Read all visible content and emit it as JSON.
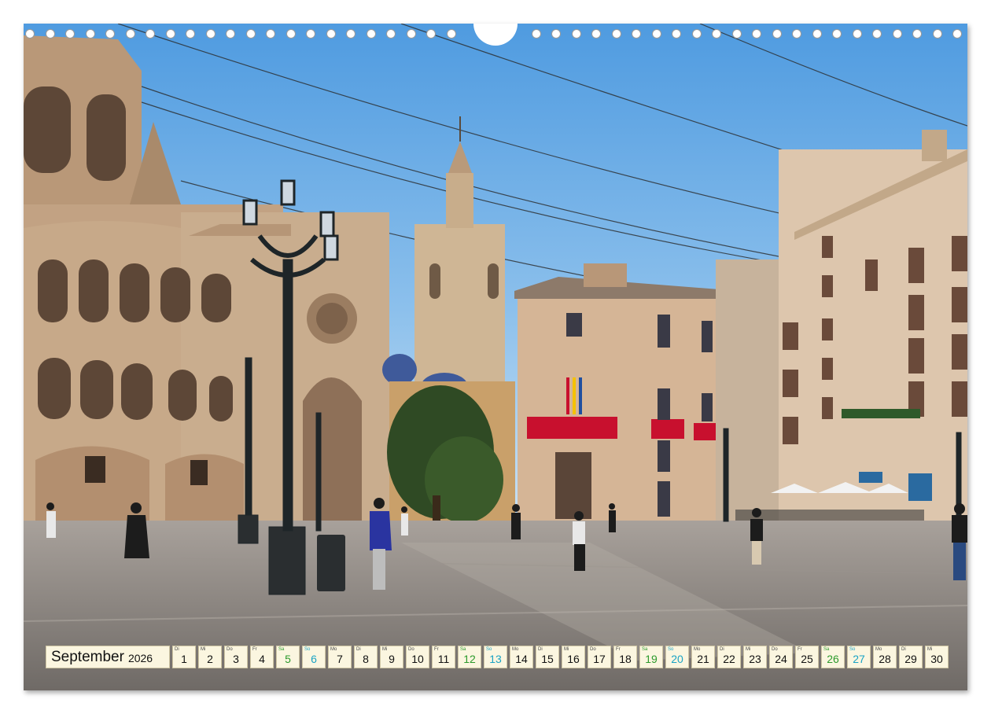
{
  "calendar": {
    "month": "September",
    "year": "2026",
    "days": [
      {
        "wd": "Di",
        "n": "1",
        "type": "wk"
      },
      {
        "wd": "Mi",
        "n": "2",
        "type": "wk"
      },
      {
        "wd": "Do",
        "n": "3",
        "type": "wk"
      },
      {
        "wd": "Fr",
        "n": "4",
        "type": "wk"
      },
      {
        "wd": "Sa",
        "n": "5",
        "type": "sat"
      },
      {
        "wd": "So",
        "n": "6",
        "type": "sun"
      },
      {
        "wd": "Mo",
        "n": "7",
        "type": "wk"
      },
      {
        "wd": "Di",
        "n": "8",
        "type": "wk"
      },
      {
        "wd": "Mi",
        "n": "9",
        "type": "wk"
      },
      {
        "wd": "Do",
        "n": "10",
        "type": "wk"
      },
      {
        "wd": "Fr",
        "n": "11",
        "type": "wk"
      },
      {
        "wd": "Sa",
        "n": "12",
        "type": "sat"
      },
      {
        "wd": "So",
        "n": "13",
        "type": "sun"
      },
      {
        "wd": "Mo",
        "n": "14",
        "type": "wk"
      },
      {
        "wd": "Di",
        "n": "15",
        "type": "wk"
      },
      {
        "wd": "Mi",
        "n": "16",
        "type": "wk"
      },
      {
        "wd": "Do",
        "n": "17",
        "type": "wk"
      },
      {
        "wd": "Fr",
        "n": "18",
        "type": "wk"
      },
      {
        "wd": "Sa",
        "n": "19",
        "type": "sat"
      },
      {
        "wd": "So",
        "n": "20",
        "type": "sun"
      },
      {
        "wd": "Mo",
        "n": "21",
        "type": "wk"
      },
      {
        "wd": "Di",
        "n": "22",
        "type": "wk"
      },
      {
        "wd": "Mi",
        "n": "23",
        "type": "wk"
      },
      {
        "wd": "Do",
        "n": "24",
        "type": "wk"
      },
      {
        "wd": "Fr",
        "n": "25",
        "type": "wk"
      },
      {
        "wd": "Sa",
        "n": "26",
        "type": "sat"
      },
      {
        "wd": "So",
        "n": "27",
        "type": "sun"
      },
      {
        "wd": "Mo",
        "n": "28",
        "type": "wk"
      },
      {
        "wd": "Di",
        "n": "29",
        "type": "wk"
      },
      {
        "wd": "Mi",
        "n": "30",
        "type": "wk"
      }
    ]
  },
  "colors": {
    "sky_top": "#4f9be0",
    "sky_bottom": "#cfe4f4",
    "stone": "#c9ad8e",
    "plaza": "#8f8a86",
    "saturday": "#2c9a2c",
    "sunday": "#1aa3c4",
    "banner_red": "#c8102e"
  }
}
